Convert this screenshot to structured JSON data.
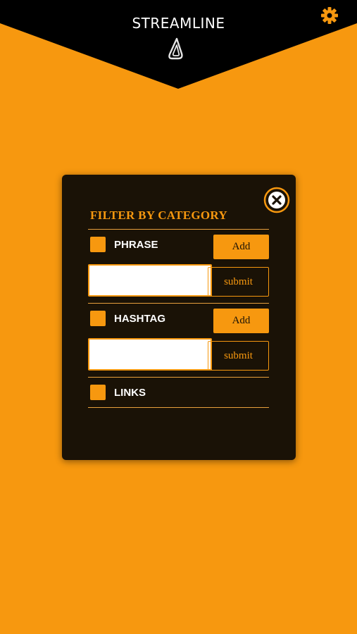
{
  "header": {
    "title": "STREAMLINE",
    "logo_icon": "streamline-logo-icon",
    "settings_icon": "gear-icon",
    "background_color": "#000000",
    "accent_color": "#f7980f"
  },
  "modal": {
    "title": "FILTER BY CATEGORY",
    "close_icon": "close-icon",
    "background_color": "#1a1206",
    "rows": [
      {
        "label": "PHRASE",
        "add_label": "Add",
        "input_value": "",
        "submit_label": "submit",
        "checked": false
      },
      {
        "label": "HASHTAG",
        "add_label": "Add",
        "input_value": "",
        "submit_label": "submit",
        "checked": false
      },
      {
        "label": "LINKS",
        "checked": false
      }
    ]
  }
}
